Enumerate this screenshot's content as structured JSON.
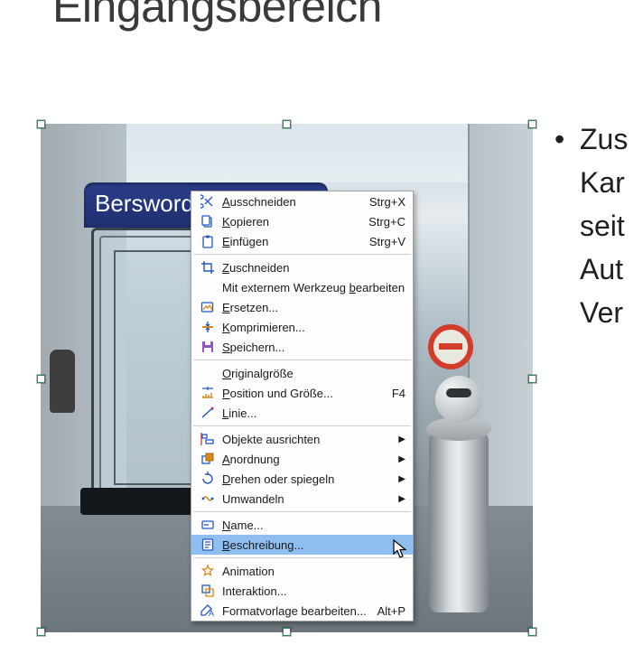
{
  "title": "Eingangsbereich",
  "bullet_text_visible": "Zus\nKar\nseit\nAut\nVer",
  "sign_text": "Berswordt-Halle",
  "menu": [
    {
      "kind": "item",
      "icon": "scissors",
      "name": "cut",
      "label": "Ausschneiden",
      "under": "A",
      "shortcut": "Strg+X"
    },
    {
      "kind": "item",
      "icon": "copy",
      "name": "copy",
      "label": "Kopieren",
      "under": "K",
      "shortcut": "Strg+C"
    },
    {
      "kind": "item",
      "icon": "paste",
      "name": "paste",
      "label": "Einfügen",
      "under": "E",
      "shortcut": "Strg+V"
    },
    {
      "kind": "sep"
    },
    {
      "kind": "item",
      "icon": "crop",
      "name": "crop",
      "label": "Zuschneiden",
      "under": "Z"
    },
    {
      "kind": "item",
      "icon": "",
      "name": "ext-edit",
      "label": "Mit externem Werkzeug bearbeiten",
      "under": "b"
    },
    {
      "kind": "item",
      "icon": "replace",
      "name": "replace",
      "label": "Ersetzen...",
      "under": "E"
    },
    {
      "kind": "item",
      "icon": "compress",
      "name": "compress",
      "label": "Komprimieren...",
      "under": "K"
    },
    {
      "kind": "item",
      "icon": "save",
      "name": "save",
      "label": "Speichern...",
      "under": "S"
    },
    {
      "kind": "sep"
    },
    {
      "kind": "item",
      "icon": "",
      "name": "orig-size",
      "label": "Originalgröße",
      "under": "O"
    },
    {
      "kind": "item",
      "icon": "possize",
      "name": "possize",
      "label": "Position und Größe...",
      "under": "P",
      "shortcut": "F4"
    },
    {
      "kind": "item",
      "icon": "line",
      "name": "line",
      "label": "Linie...",
      "under": "L"
    },
    {
      "kind": "sep"
    },
    {
      "kind": "item",
      "icon": "align",
      "name": "align",
      "label": "Objekte ausrichten",
      "under": "",
      "sub": true
    },
    {
      "kind": "item",
      "icon": "arrange",
      "name": "arrange",
      "label": "Anordnung",
      "under": "A",
      "sub": true
    },
    {
      "kind": "item",
      "icon": "rotate",
      "name": "rotate",
      "label": "Drehen oder spiegeln",
      "under": "D",
      "sub": true
    },
    {
      "kind": "item",
      "icon": "convert",
      "name": "convert",
      "label": "Umwandeln",
      "under": "",
      "sub": true
    },
    {
      "kind": "sep"
    },
    {
      "kind": "item",
      "icon": "nametag",
      "name": "name",
      "label": "Name...",
      "under": "N"
    },
    {
      "kind": "item",
      "icon": "desc",
      "name": "description",
      "label": "Beschreibung...",
      "under": "B",
      "highlight": true
    },
    {
      "kind": "sep"
    },
    {
      "kind": "item",
      "icon": "star",
      "name": "animation",
      "label": "Animation",
      "under": ""
    },
    {
      "kind": "item",
      "icon": "interact",
      "name": "interaction",
      "label": "Interaktion...",
      "under": ""
    },
    {
      "kind": "item",
      "icon": "styleedit",
      "name": "edit-style",
      "label": "Formatvorlage bearbeiten...",
      "under": "",
      "shortcut": "Alt+P"
    }
  ]
}
